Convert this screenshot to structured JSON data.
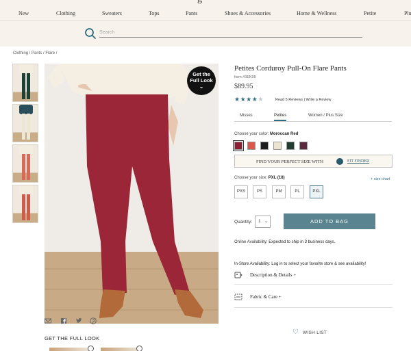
{
  "brand": {
    "logo_fragment": "g"
  },
  "nav": {
    "items": [
      "New",
      "Clothing",
      "Sweaters",
      "Tops",
      "Pants",
      "Shoes & Accessories",
      "Home & Wellness",
      "Petite",
      "Plu"
    ]
  },
  "search": {
    "placeholder": "Search"
  },
  "breadcrumb": [
    "Clothing /",
    "Pants /",
    "Flare /"
  ],
  "gallery": {
    "thumbnails": [
      {
        "pants_color": "#1f4034"
      },
      {
        "pants_color": "#efe7d6"
      },
      {
        "pants_color": "#d86a5a"
      },
      {
        "pants_color": "#cf5b4b"
      }
    ],
    "main_pants_color": "#9b2637",
    "get_full_look": {
      "line1": "Get the",
      "line2": "Full Look",
      "chevron": "⌄"
    }
  },
  "share": {
    "icons": [
      "email-icon",
      "facebook-icon",
      "twitter-icon",
      "pinterest-icon"
    ]
  },
  "full_look": {
    "title": "GET THE FULL LOOK"
  },
  "product": {
    "title": "Petites Corduroy Pull-On Flare Pants",
    "item_number": "Item #3EK05",
    "price": "$89.95",
    "rating": 4,
    "rating_max": 5,
    "reviews_link": "Read 5 Reviews",
    "separator": "|",
    "write_review": "Write a Review"
  },
  "fit_tabs": {
    "items": [
      "Misses",
      "Petites",
      "Women / Plus Size"
    ],
    "active": "Petites"
  },
  "color": {
    "label": "Choose your color:",
    "selected": "Moroccan Red",
    "swatches": [
      "#8c1f33",
      "#d8584d",
      "#1d1d1d",
      "#ece3d1",
      "#223c31",
      "#5b2a3d"
    ],
    "selected_index": 0
  },
  "size_finder": {
    "text": "FIND YOUR PERFECT SIZE WITH",
    "link": "FIT FINDER"
  },
  "size": {
    "label": "Choose your size:",
    "selected": "PXL (18)",
    "size_chart": "+ size chart",
    "options": [
      "PXS",
      "PS",
      "PM",
      "PL",
      "PXL"
    ],
    "selected_option": "PXL"
  },
  "cart": {
    "quantity_label": "Quantity:",
    "quantity_value": "1",
    "chevron": "⌄",
    "add_to_bag": "ADD TO BAG"
  },
  "availability": {
    "online_label": "Online Availability:",
    "online_value": "Expected to ship in 3 business days.",
    "instore_label": "In-Store Availability:",
    "instore_value": "Log in to select your favorite store & see availability!"
  },
  "accordions": {
    "description": "Description & Details",
    "fabric": "Fabric & Care",
    "plus": "+"
  },
  "wishlist": {
    "label": "WISH LIST",
    "icon": "♡"
  }
}
